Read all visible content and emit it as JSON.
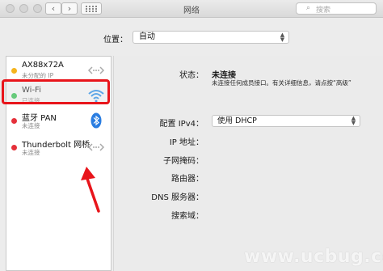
{
  "window": {
    "title": "网络"
  },
  "toolbar": {
    "back_glyph": "‹",
    "forward_glyph": "›",
    "search_glyph": "⌕",
    "search_placeholder": "搜索"
  },
  "location": {
    "label": "位置：",
    "value": "自动"
  },
  "services": [
    {
      "name": "AX88x72A",
      "status": "未分配的 IP",
      "dot_color": "#f5b41e",
      "icon": "ethernet-arrows-icon"
    },
    {
      "name": "Wi-Fi",
      "status": "已连接",
      "dot_color": "#2bc44a",
      "icon": "wifi-icon"
    },
    {
      "name": "蓝牙 PAN",
      "status": "未连接",
      "dot_color": "#e5303a",
      "icon": "bluetooth-icon"
    },
    {
      "name": "Thunderbolt 网桥",
      "status": "未连接",
      "dot_color": "#e5303a",
      "icon": "ethernet-arrows-icon"
    }
  ],
  "detail": {
    "status_label": "状态：",
    "status_value": "未连接",
    "status_desc": "未连接任何成员接口。有关详细信息，请点按“高级”",
    "ipv4_label": "配置 IPv4：",
    "ipv4_value": "使用 DHCP",
    "ip_label": "IP 地址：",
    "subnet_label": "子网掩码：",
    "router_label": "路由器：",
    "dns_label": "DNS 服务器：",
    "search_domain_label": "搜索域："
  },
  "annotation": {
    "color": "#e8151b"
  },
  "watermark": "www.ucbug.cc"
}
